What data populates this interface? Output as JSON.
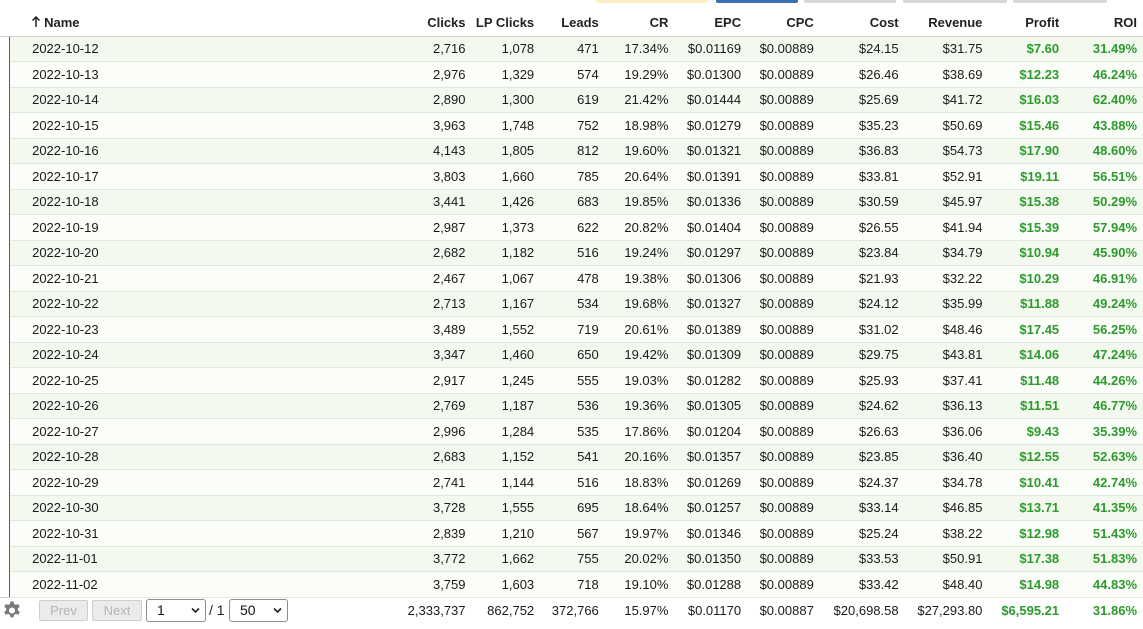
{
  "columns": {
    "name": "Name",
    "clicks": "Clicks",
    "lp_clicks": "LP Clicks",
    "leads": "Leads",
    "cr": "CR",
    "epc": "EPC",
    "cpc": "CPC",
    "cost": "Cost",
    "revenue": "Revenue",
    "profit": "Profit",
    "roi": "ROI"
  },
  "sort_icon": "arrow-up-icon",
  "rows": [
    {
      "name": "2022-10-12",
      "clicks": "2,716",
      "lp_clicks": "1,078",
      "leads": "471",
      "cr": "17.34%",
      "epc": "$0.01169",
      "cpc": "$0.00889",
      "cost": "$24.15",
      "revenue": "$31.75",
      "profit": "$7.60",
      "roi": "31.49%"
    },
    {
      "name": "2022-10-13",
      "clicks": "2,976",
      "lp_clicks": "1,329",
      "leads": "574",
      "cr": "19.29%",
      "epc": "$0.01300",
      "cpc": "$0.00889",
      "cost": "$26.46",
      "revenue": "$38.69",
      "profit": "$12.23",
      "roi": "46.24%"
    },
    {
      "name": "2022-10-14",
      "clicks": "2,890",
      "lp_clicks": "1,300",
      "leads": "619",
      "cr": "21.42%",
      "epc": "$0.01444",
      "cpc": "$0.00889",
      "cost": "$25.69",
      "revenue": "$41.72",
      "profit": "$16.03",
      "roi": "62.40%"
    },
    {
      "name": "2022-10-15",
      "clicks": "3,963",
      "lp_clicks": "1,748",
      "leads": "752",
      "cr": "18.98%",
      "epc": "$0.01279",
      "cpc": "$0.00889",
      "cost": "$35.23",
      "revenue": "$50.69",
      "profit": "$15.46",
      "roi": "43.88%"
    },
    {
      "name": "2022-10-16",
      "clicks": "4,143",
      "lp_clicks": "1,805",
      "leads": "812",
      "cr": "19.60%",
      "epc": "$0.01321",
      "cpc": "$0.00889",
      "cost": "$36.83",
      "revenue": "$54.73",
      "profit": "$17.90",
      "roi": "48.60%"
    },
    {
      "name": "2022-10-17",
      "clicks": "3,803",
      "lp_clicks": "1,660",
      "leads": "785",
      "cr": "20.64%",
      "epc": "$0.01391",
      "cpc": "$0.00889",
      "cost": "$33.81",
      "revenue": "$52.91",
      "profit": "$19.11",
      "roi": "56.51%"
    },
    {
      "name": "2022-10-18",
      "clicks": "3,441",
      "lp_clicks": "1,426",
      "leads": "683",
      "cr": "19.85%",
      "epc": "$0.01336",
      "cpc": "$0.00889",
      "cost": "$30.59",
      "revenue": "$45.97",
      "profit": "$15.38",
      "roi": "50.29%"
    },
    {
      "name": "2022-10-19",
      "clicks": "2,987",
      "lp_clicks": "1,373",
      "leads": "622",
      "cr": "20.82%",
      "epc": "$0.01404",
      "cpc": "$0.00889",
      "cost": "$26.55",
      "revenue": "$41.94",
      "profit": "$15.39",
      "roi": "57.94%"
    },
    {
      "name": "2022-10-20",
      "clicks": "2,682",
      "lp_clicks": "1,182",
      "leads": "516",
      "cr": "19.24%",
      "epc": "$0.01297",
      "cpc": "$0.00889",
      "cost": "$23.84",
      "revenue": "$34.79",
      "profit": "$10.94",
      "roi": "45.90%"
    },
    {
      "name": "2022-10-21",
      "clicks": "2,467",
      "lp_clicks": "1,067",
      "leads": "478",
      "cr": "19.38%",
      "epc": "$0.01306",
      "cpc": "$0.00889",
      "cost": "$21.93",
      "revenue": "$32.22",
      "profit": "$10.29",
      "roi": "46.91%"
    },
    {
      "name": "2022-10-22",
      "clicks": "2,713",
      "lp_clicks": "1,167",
      "leads": "534",
      "cr": "19.68%",
      "epc": "$0.01327",
      "cpc": "$0.00889",
      "cost": "$24.12",
      "revenue": "$35.99",
      "profit": "$11.88",
      "roi": "49.24%"
    },
    {
      "name": "2022-10-23",
      "clicks": "3,489",
      "lp_clicks": "1,552",
      "leads": "719",
      "cr": "20.61%",
      "epc": "$0.01389",
      "cpc": "$0.00889",
      "cost": "$31.02",
      "revenue": "$48.46",
      "profit": "$17.45",
      "roi": "56.25%"
    },
    {
      "name": "2022-10-24",
      "clicks": "3,347",
      "lp_clicks": "1,460",
      "leads": "650",
      "cr": "19.42%",
      "epc": "$0.01309",
      "cpc": "$0.00889",
      "cost": "$29.75",
      "revenue": "$43.81",
      "profit": "$14.06",
      "roi": "47.24%"
    },
    {
      "name": "2022-10-25",
      "clicks": "2,917",
      "lp_clicks": "1,245",
      "leads": "555",
      "cr": "19.03%",
      "epc": "$0.01282",
      "cpc": "$0.00889",
      "cost": "$25.93",
      "revenue": "$37.41",
      "profit": "$11.48",
      "roi": "44.26%"
    },
    {
      "name": "2022-10-26",
      "clicks": "2,769",
      "lp_clicks": "1,187",
      "leads": "536",
      "cr": "19.36%",
      "epc": "$0.01305",
      "cpc": "$0.00889",
      "cost": "$24.62",
      "revenue": "$36.13",
      "profit": "$11.51",
      "roi": "46.77%"
    },
    {
      "name": "2022-10-27",
      "clicks": "2,996",
      "lp_clicks": "1,284",
      "leads": "535",
      "cr": "17.86%",
      "epc": "$0.01204",
      "cpc": "$0.00889",
      "cost": "$26.63",
      "revenue": "$36.06",
      "profit": "$9.43",
      "roi": "35.39%"
    },
    {
      "name": "2022-10-28",
      "clicks": "2,683",
      "lp_clicks": "1,152",
      "leads": "541",
      "cr": "20.16%",
      "epc": "$0.01357",
      "cpc": "$0.00889",
      "cost": "$23.85",
      "revenue": "$36.40",
      "profit": "$12.55",
      "roi": "52.63%"
    },
    {
      "name": "2022-10-29",
      "clicks": "2,741",
      "lp_clicks": "1,144",
      "leads": "516",
      "cr": "18.83%",
      "epc": "$0.01269",
      "cpc": "$0.00889",
      "cost": "$24.37",
      "revenue": "$34.78",
      "profit": "$10.41",
      "roi": "42.74%"
    },
    {
      "name": "2022-10-30",
      "clicks": "3,728",
      "lp_clicks": "1,555",
      "leads": "695",
      "cr": "18.64%",
      "epc": "$0.01257",
      "cpc": "$0.00889",
      "cost": "$33.14",
      "revenue": "$46.85",
      "profit": "$13.71",
      "roi": "41.35%"
    },
    {
      "name": "2022-10-31",
      "clicks": "2,839",
      "lp_clicks": "1,210",
      "leads": "567",
      "cr": "19.97%",
      "epc": "$0.01346",
      "cpc": "$0.00889",
      "cost": "$25.24",
      "revenue": "$38.22",
      "profit": "$12.98",
      "roi": "51.43%"
    },
    {
      "name": "2022-11-01",
      "clicks": "3,772",
      "lp_clicks": "1,662",
      "leads": "755",
      "cr": "20.02%",
      "epc": "$0.01350",
      "cpc": "$0.00889",
      "cost": "$33.53",
      "revenue": "$50.91",
      "profit": "$17.38",
      "roi": "51.83%"
    },
    {
      "name": "2022-11-02",
      "clicks": "3,759",
      "lp_clicks": "1,603",
      "leads": "718",
      "cr": "19.10%",
      "epc": "$0.01288",
      "cpc": "$0.00889",
      "cost": "$33.42",
      "revenue": "$48.40",
      "profit": "$14.98",
      "roi": "44.83%"
    }
  ],
  "totals": {
    "clicks": "2,333,737",
    "lp_clicks": "862,752",
    "leads": "372,766",
    "cr": "15.97%",
    "epc": "$0.01170",
    "cpc": "$0.00887",
    "cost": "$20,698.58",
    "revenue": "$27,293.80",
    "profit": "$6,595.21",
    "roi": "31.86%"
  },
  "pagination": {
    "settings_icon": "gear-icon",
    "prev_label": "Prev",
    "next_label": "Next",
    "page_value": "1",
    "of_total": "/ 1",
    "page_size_value": "50"
  },
  "colors": {
    "positive": "#2c9a2c",
    "row_indicator": "#1d8a1d",
    "active_tab": "#3a6fb5"
  }
}
